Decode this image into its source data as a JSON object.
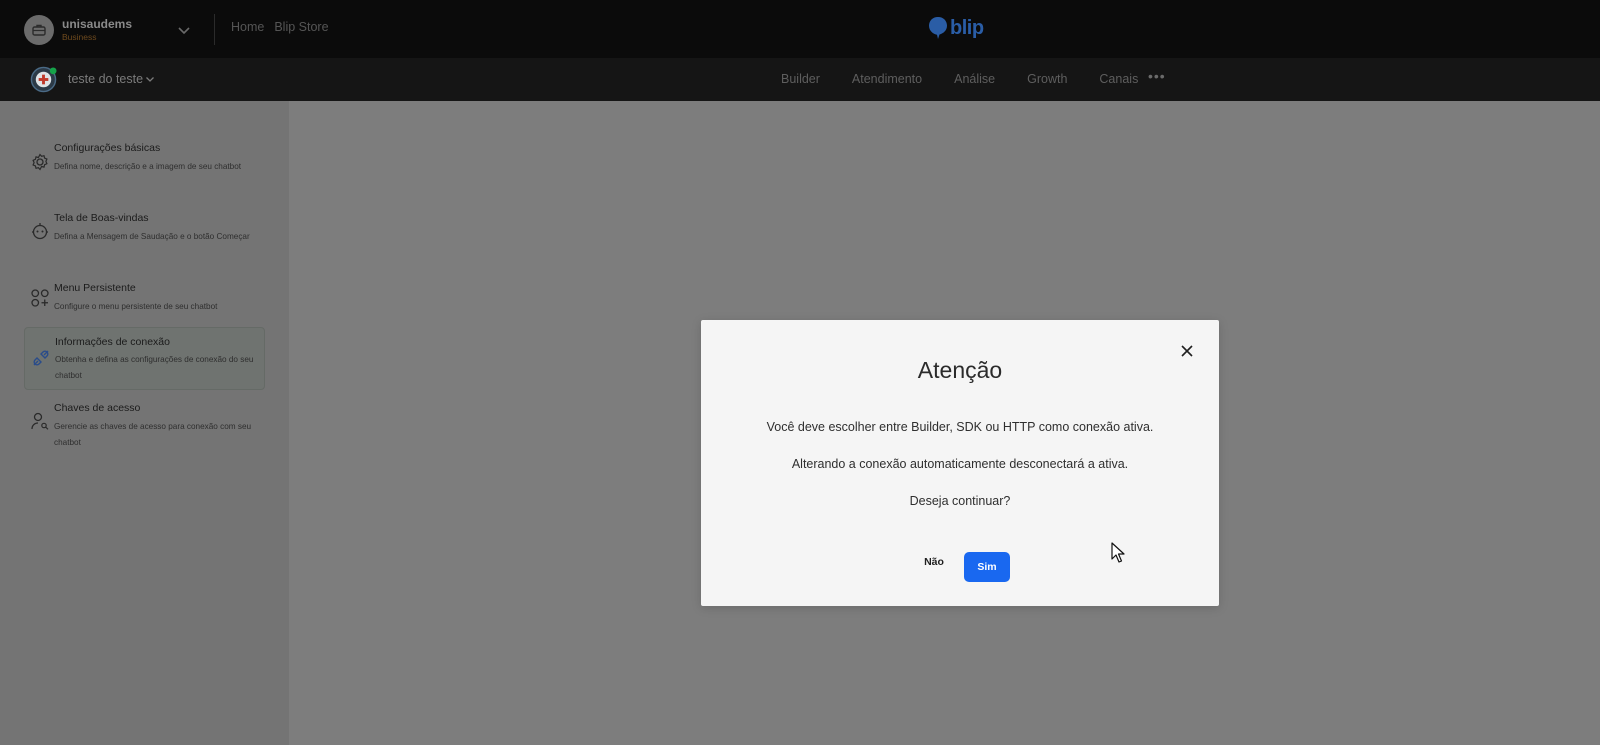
{
  "topbar": {
    "org_name": "unisaudems",
    "org_plan": "Business",
    "links": [
      "Home",
      "Blip Store"
    ],
    "brand": "blip"
  },
  "subbar": {
    "bot_name": "teste do teste",
    "tabs": [
      "Builder",
      "Atendimento",
      "Análise",
      "Growth",
      "Canais"
    ],
    "more": "•••"
  },
  "sidebar": {
    "items": [
      {
        "title": "Configurações básicas",
        "desc": "Defina nome, descrição e a imagem de seu chatbot"
      },
      {
        "title": "Tela de Boas-vindas",
        "desc": "Defina a Mensagem de Saudação e o botão Começar"
      },
      {
        "title": "Menu Persistente",
        "desc": "Configure o menu persistente de seu chatbot"
      },
      {
        "title": "Informações de conexão",
        "desc": "Obtenha e defina as configurações de conexão do seu chatbot"
      },
      {
        "title": "Chaves de acesso",
        "desc": "Gerencie as chaves de acesso para conexão com seu chatbot"
      }
    ]
  },
  "modal": {
    "title": "Atenção",
    "lines": [
      "Você deve escolher entre Builder, SDK ou HTTP como conexão ativa.",
      "Alterando a conexão automaticamente desconectará a ativa.",
      "Deseja continuar?"
    ],
    "no_label": "Não",
    "yes_label": "Sim"
  },
  "colors": {
    "accent": "#1968f0",
    "brand": "#2a5da6",
    "plan": "#6e4a1e"
  }
}
